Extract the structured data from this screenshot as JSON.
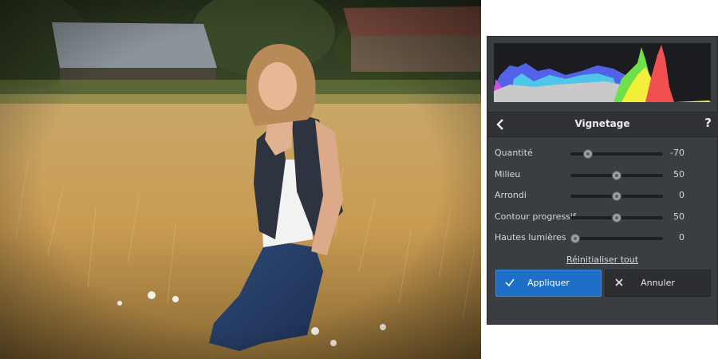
{
  "photo": {
    "subject": "woman-in-wheat-field"
  },
  "panel": {
    "title": "Vignetage",
    "back_icon": "chevron-left-icon",
    "help_label": "?",
    "sliders": [
      {
        "label": "Quantité",
        "value": "-70",
        "fraction": 0.19
      },
      {
        "label": "Milieu",
        "value": "50",
        "fraction": 0.5
      },
      {
        "label": "Arrondi",
        "value": "0",
        "fraction": 0.5
      },
      {
        "label": "Contour progressif",
        "value": "50",
        "fraction": 0.5
      },
      {
        "label": "Hautes lumières",
        "value": "0",
        "fraction": 0.05
      }
    ],
    "reset_label": "Réinitialiser tout",
    "apply_label": "Appliquer",
    "cancel_label": "Annuler",
    "colors": {
      "accent": "#1e6fc8",
      "panel_bg": "#3a3d42"
    }
  }
}
